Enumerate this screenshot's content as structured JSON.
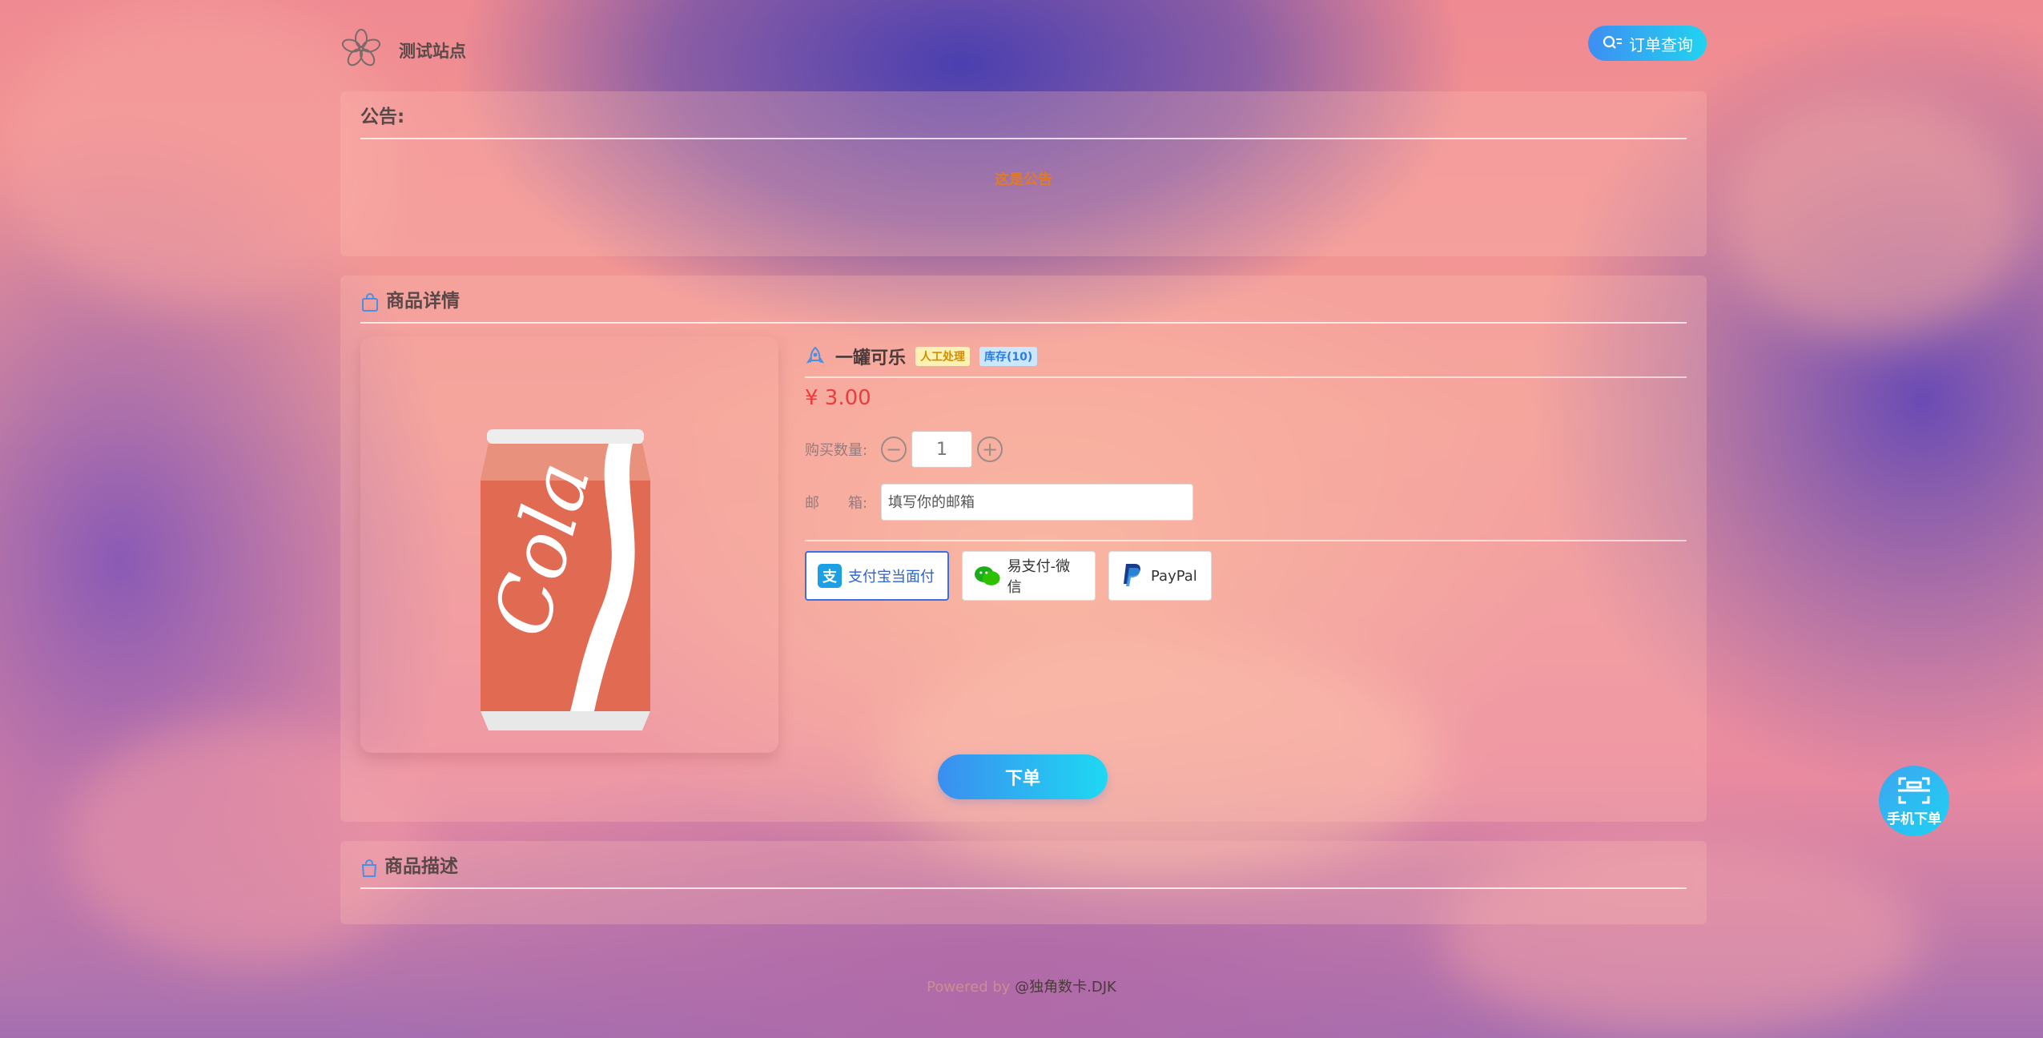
{
  "header": {
    "site_title": "测试站点",
    "order_query_label": "订单查询"
  },
  "notice": {
    "title": "公告:",
    "content": "这是公告"
  },
  "detail": {
    "section_title": "商品详情",
    "product_name": "一罐可乐",
    "tag_manual": "人工处理",
    "tag_stock": "库存(10)",
    "price": "¥ 3.00",
    "quantity_label": "购买数量:",
    "quantity_value": "1",
    "email_label": "邮　　箱:",
    "email_placeholder": "填写你的邮箱",
    "payments": [
      {
        "label": "支付宝当面付",
        "selected": true
      },
      {
        "label": "易支付-微信",
        "selected": false
      },
      {
        "label": "PayPal",
        "selected": false
      }
    ],
    "submit_label": "下单"
  },
  "description": {
    "section_title": "商品描述"
  },
  "footer": {
    "powered": "Powered by ",
    "brand": "@独角数卡.DJK"
  },
  "mobile_order": {
    "label": "手机下单"
  },
  "colors": {
    "primary_gradient_start": "#3b8ef0",
    "primary_gradient_end": "#1ed8f2",
    "price": "#ea3d3d",
    "notice_text": "#e07a2a"
  },
  "icons": {
    "logo": "flower-icon",
    "order_query": "search-list-icon",
    "detail_section": "shopping-bag-icon",
    "description_section": "bag-icon",
    "product_name": "rocket-icon",
    "alipay": "alipay-icon",
    "wechat": "wechat-icon",
    "paypal": "paypal-icon",
    "mobile_order": "scan-icon"
  }
}
